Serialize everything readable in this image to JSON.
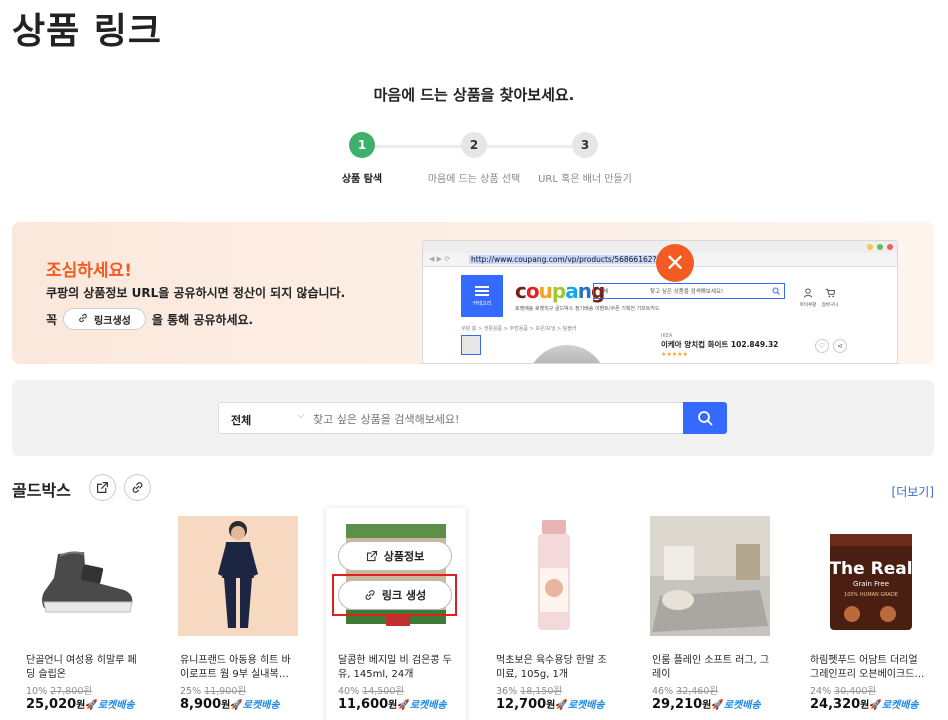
{
  "page_title": "상품 링크",
  "subtitle": "마음에 드는 상품을 찾아보세요.",
  "steps": [
    {
      "num": "1",
      "label": "상품 탐색"
    },
    {
      "num": "2",
      "label": "마음에 드는 상품 선택"
    },
    {
      "num": "3",
      "label": "URL 혹은 배너 만들기"
    }
  ],
  "active_step": 1,
  "warning": {
    "title": "조심하세요!",
    "line1": "쿠팡의 상품정보 URL을 공유하시면 정산이 되지 않습니다.",
    "line2_prefix": "꼭",
    "line2_button": "링크생성",
    "line2_suffix": "을 통해 공유하세요.",
    "browser_url": "http://www.coupang.com/vp/products/56866162?itemId",
    "menu_label": "카테고리",
    "logo": "coupang",
    "search_cat": "전체",
    "search_placeholder": "찾고 싶은 상품을 검색해보세요!",
    "nav_items": "로켓배송   로켓직구   골드박스   정기배송   이벤트/쿠폰   기획전   기프트카드",
    "breadcrumb": "쿠팡 홈  >  생활용품  >  주방용품  >  보온/보냉  >  텀블러",
    "product_brand": "IKEA",
    "product_name": "이케아 양치컵 화이트 102.849.32",
    "user_labels": [
      "마이쿠팡",
      "장바구니"
    ],
    "colors": {
      "accent": "#f25c22",
      "coupang_blue": "#346aff"
    }
  },
  "search": {
    "category": "전체",
    "placeholder": "찾고 싶은 상품을 검색해보세요!"
  },
  "goldbox": {
    "title": "골드박스",
    "more": "[더보기]"
  },
  "hover_buttons": {
    "info": "상품정보",
    "link": "링크 생성"
  },
  "rocket_label": "로켓배송",
  "products": [
    {
      "name": "단골언니 여성용 히말루 페딩 슬립온",
      "discount": "10%",
      "original": "27,800원",
      "price": "25,020",
      "unit": "원"
    },
    {
      "name": "유니프랜드 아동용 히트 바이로프트 웜 9부 실내복…",
      "discount": "25%",
      "original": "11,900원",
      "price": "8,900",
      "unit": "원"
    },
    {
      "name": "달콤한 베지밀 비 검은콩 두유, 145ml, 24개",
      "discount": "40%",
      "original": "14,500원",
      "price": "11,600",
      "unit": "원"
    },
    {
      "name": "먹초보은 육수용당 한알 조미료, 105g, 1개",
      "discount": "36%",
      "original": "18,150원",
      "price": "12,700",
      "unit": "원"
    },
    {
      "name": "인룸 플레인 소프트 러그, 그레이",
      "discount": "46%",
      "original": "32,460원",
      "price": "29,210",
      "unit": "원"
    },
    {
      "name": "하림펫푸드 어담트 더리얼 그레인프리 오븐베이크드…",
      "discount": "24%",
      "original": "30,400원",
      "price": "24,320",
      "unit": "원"
    }
  ],
  "product_image_texts": {
    "brand_label": "The Real",
    "brand_sub": "Grain Free",
    "brand_tag": "100% HUMAN GRADE"
  }
}
